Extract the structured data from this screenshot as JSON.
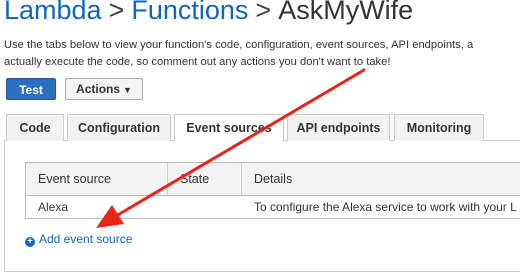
{
  "breadcrumb": {
    "lambda": "Lambda",
    "sep1": ">",
    "functions": "Functions",
    "sep2": ">",
    "current": "AskMyWife"
  },
  "description": {
    "line1": "Use the tabs below to view your function's code, configuration, event sources, API endpoints, a",
    "line2": "actually execute the code, so comment out any actions you don't want to take!"
  },
  "buttons": {
    "test": "Test",
    "actions": "Actions",
    "actions_caret": "▼"
  },
  "tabs": [
    {
      "label": "Code",
      "active": false
    },
    {
      "label": "Configuration",
      "active": false
    },
    {
      "label": "Event sources",
      "active": true
    },
    {
      "label": "API endpoints",
      "active": false
    },
    {
      "label": "Monitoring",
      "active": false
    }
  ],
  "table": {
    "headers": [
      "Event source",
      "State",
      "Details"
    ],
    "rows": [
      {
        "event_source": "Alexa",
        "state": "",
        "details": "To configure the Alexa service to work with your L"
      }
    ]
  },
  "add_event_source": {
    "icon": "plus-circle-icon",
    "label": "Add event source"
  },
  "colors": {
    "link": "#1166bb",
    "primary_button": "#2b6fc1",
    "annotation_arrow": "#e8231a"
  }
}
